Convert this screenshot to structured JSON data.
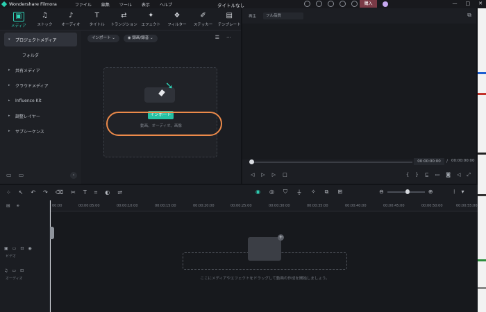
{
  "app": {
    "name": "Wondershare Filmora",
    "doc_title": "タイトルなし",
    "buy_label": "購入"
  },
  "menu": [
    "ファイル",
    "編集",
    "ツール",
    "表示",
    "ヘルプ"
  ],
  "window_controls": [
    "—",
    "□",
    "✕"
  ],
  "toolbar": [
    {
      "icon": "▣",
      "label": "メディア"
    },
    {
      "icon": "♫",
      "label": "ストック"
    },
    {
      "icon": "♪",
      "label": "オーディオ"
    },
    {
      "icon": "T",
      "label": "タイトル"
    },
    {
      "icon": "⇄",
      "label": "トランジション"
    },
    {
      "icon": "✦",
      "label": "エフェクト"
    },
    {
      "icon": "❖",
      "label": "フィルター"
    },
    {
      "icon": "✐",
      "label": "ステッカー"
    },
    {
      "icon": "▤",
      "label": "テンプレート"
    }
  ],
  "sidebar": {
    "items": [
      {
        "label": "プロジェクトメディア",
        "arrow": "▾"
      },
      {
        "label": "フォルダ",
        "arrow": ""
      },
      {
        "label": "共有メディア",
        "arrow": "▸"
      },
      {
        "label": "クラウドメディア",
        "arrow": "▸"
      },
      {
        "label": "Influence Kit",
        "arrow": "▸"
      },
      {
        "label": "調整レイヤー",
        "arrow": "▸"
      },
      {
        "label": "サブシーケンス",
        "arrow": "▸"
      }
    ],
    "collapse": "‹"
  },
  "media": {
    "import_dropdown": "インポート ⌄",
    "record_dropdown": "◉ 録画/録音 ⌄",
    "import_button": "インポート",
    "drop_hint": "動画、オーディオ、画像"
  },
  "preview": {
    "label": "再生",
    "quality": "フル品質",
    "current_time": "00:00:00:00",
    "separator": "/",
    "total_time": "00:00:00:00"
  },
  "timeline": {
    "ticks": [
      "00:00",
      "00:00:05:00",
      "00:00:10:00",
      "00:00:15:00",
      "00:00:20:00",
      "00:00:25:00",
      "00:00:30:00",
      "00:00:35:00",
      "00:00:40:00",
      "00:00:45:00",
      "00:00:50:00",
      "00:00:55:00"
    ],
    "video_track": "ビデオ",
    "audio_track": "オーディオ",
    "hint": "ここにメディアやエフェクトをドラッグして動画の作成を開始しましょう。"
  }
}
